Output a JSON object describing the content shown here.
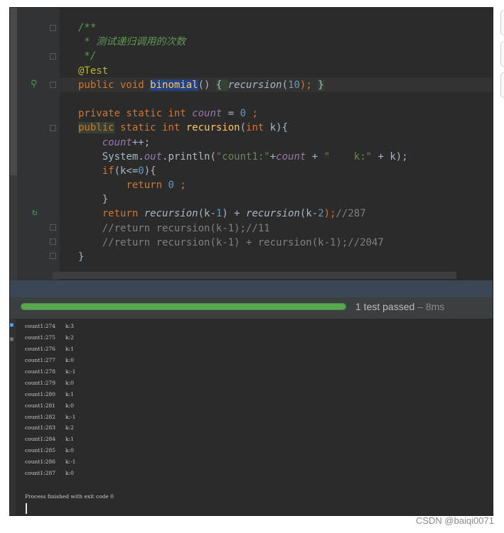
{
  "editor": {
    "lines": [
      {
        "parts": [
          {
            "t": "/**",
            "c": "cm"
          }
        ]
      },
      {
        "parts": [
          {
            "t": " * 测试递归调用的次数",
            "c": "cm"
          }
        ]
      },
      {
        "parts": [
          {
            "t": " */",
            "c": "cm"
          }
        ]
      },
      {
        "parts": [
          {
            "t": "@Test",
            "c": "ann"
          }
        ]
      },
      {
        "parts": [
          {
            "t": "public void ",
            "c": "kw"
          },
          {
            "t": "binomial",
            "c": "hl"
          },
          {
            "t": "() ",
            "c": ""
          },
          {
            "t": "{ ",
            "c": "hl2"
          },
          {
            "t": "recursion",
            "c": "call"
          },
          {
            "t": "(",
            "c": ""
          },
          {
            "t": "10",
            "c": "num"
          },
          {
            "t": "); ",
            "c": "kw"
          },
          {
            "t": "}",
            "c": "hl2"
          }
        ]
      },
      {
        "parts": [
          {
            "t": "",
            "c": ""
          }
        ]
      },
      {
        "parts": [
          {
            "t": "private static int ",
            "c": "kw"
          },
          {
            "t": "count",
            "c": "fld"
          },
          {
            "t": " = ",
            "c": ""
          },
          {
            "t": "0",
            "c": "num"
          },
          {
            "t": " ;",
            "c": "kw"
          }
        ]
      },
      {
        "parts": [
          {
            "t": "public",
            "c": "kw hl2"
          },
          {
            "t": " static int ",
            "c": "kw"
          },
          {
            "t": "recursion",
            "c": "fn"
          },
          {
            "t": "(",
            "c": ""
          },
          {
            "t": "int ",
            "c": "kw"
          },
          {
            "t": "k){",
            "c": ""
          }
        ]
      },
      {
        "parts": [
          {
            "t": "    ",
            "c": ""
          },
          {
            "t": "count",
            "c": "fld"
          },
          {
            "t": "++;",
            "c": ""
          }
        ]
      },
      {
        "parts": [
          {
            "t": "    System.",
            "c": ""
          },
          {
            "t": "out",
            "c": "fld"
          },
          {
            "t": ".println(",
            "c": ""
          },
          {
            "t": "\"count1:\"",
            "c": "str"
          },
          {
            "t": "+",
            "c": ""
          },
          {
            "t": "count",
            "c": "fld"
          },
          {
            "t": " + ",
            "c": ""
          },
          {
            "t": "\"    k:\"",
            "c": "str"
          },
          {
            "t": " + k);",
            "c": ""
          }
        ]
      },
      {
        "parts": [
          {
            "t": "    ",
            "c": ""
          },
          {
            "t": "if",
            "c": "kw"
          },
          {
            "t": "(k<=",
            "c": ""
          },
          {
            "t": "0",
            "c": "num"
          },
          {
            "t": "){",
            "c": ""
          }
        ]
      },
      {
        "parts": [
          {
            "t": "        ",
            "c": ""
          },
          {
            "t": "return ",
            "c": "kw"
          },
          {
            "t": "0",
            "c": "num"
          },
          {
            "t": " ;",
            "c": "kw"
          }
        ]
      },
      {
        "parts": [
          {
            "t": "    }",
            "c": ""
          }
        ]
      },
      {
        "parts": [
          {
            "t": "    ",
            "c": ""
          },
          {
            "t": "return ",
            "c": "kw"
          },
          {
            "t": "recursion",
            "c": "call"
          },
          {
            "t": "(k-",
            "c": ""
          },
          {
            "t": "1",
            "c": "num"
          },
          {
            "t": ") + ",
            "c": ""
          },
          {
            "t": "recursion",
            "c": "call"
          },
          {
            "t": "(k-",
            "c": ""
          },
          {
            "t": "2",
            "c": "num"
          },
          {
            "t": ");",
            "c": "kw"
          },
          {
            "t": "//287",
            "c": "ln-cm"
          }
        ]
      },
      {
        "parts": [
          {
            "t": "    //return recursion(k-1);//11",
            "c": "ln-cm"
          }
        ]
      },
      {
        "parts": [
          {
            "t": "    //return recursion(k-1) + recursion(k-1);//2047",
            "c": "ln-cm"
          }
        ]
      },
      {
        "parts": [
          {
            "t": "}",
            "c": ""
          }
        ]
      }
    ]
  },
  "run": {
    "progress": 1.0,
    "status_label": "1 test passed",
    "status_time": " – 8ms"
  },
  "console": {
    "rows": [
      {
        "count": "count1:274",
        "k": "k:3"
      },
      {
        "count": "count1:275",
        "k": "k:2"
      },
      {
        "count": "count1:276",
        "k": "k:1"
      },
      {
        "count": "count1:277",
        "k": "k:0"
      },
      {
        "count": "count1:278",
        "k": "k:-1"
      },
      {
        "count": "count1:279",
        "k": "k:0"
      },
      {
        "count": "count1:280",
        "k": "k:1"
      },
      {
        "count": "count1:281",
        "k": "k:0"
      },
      {
        "count": "count1:282",
        "k": "k:-1"
      },
      {
        "count": "count1:283",
        "k": "k:2"
      },
      {
        "count": "count1:284",
        "k": "k:1"
      },
      {
        "count": "count1:285",
        "k": "k:0"
      },
      {
        "count": "count1:286",
        "k": "k:-1"
      },
      {
        "count": "count1:287",
        "k": "k:0"
      }
    ],
    "finish_message": "Process finished with exit code 0"
  },
  "watermark": "CSDN @baiqi0071",
  "colors": {
    "accent_pass": "#59a750",
    "background": "#2b2b2b",
    "selection": "#214283"
  }
}
